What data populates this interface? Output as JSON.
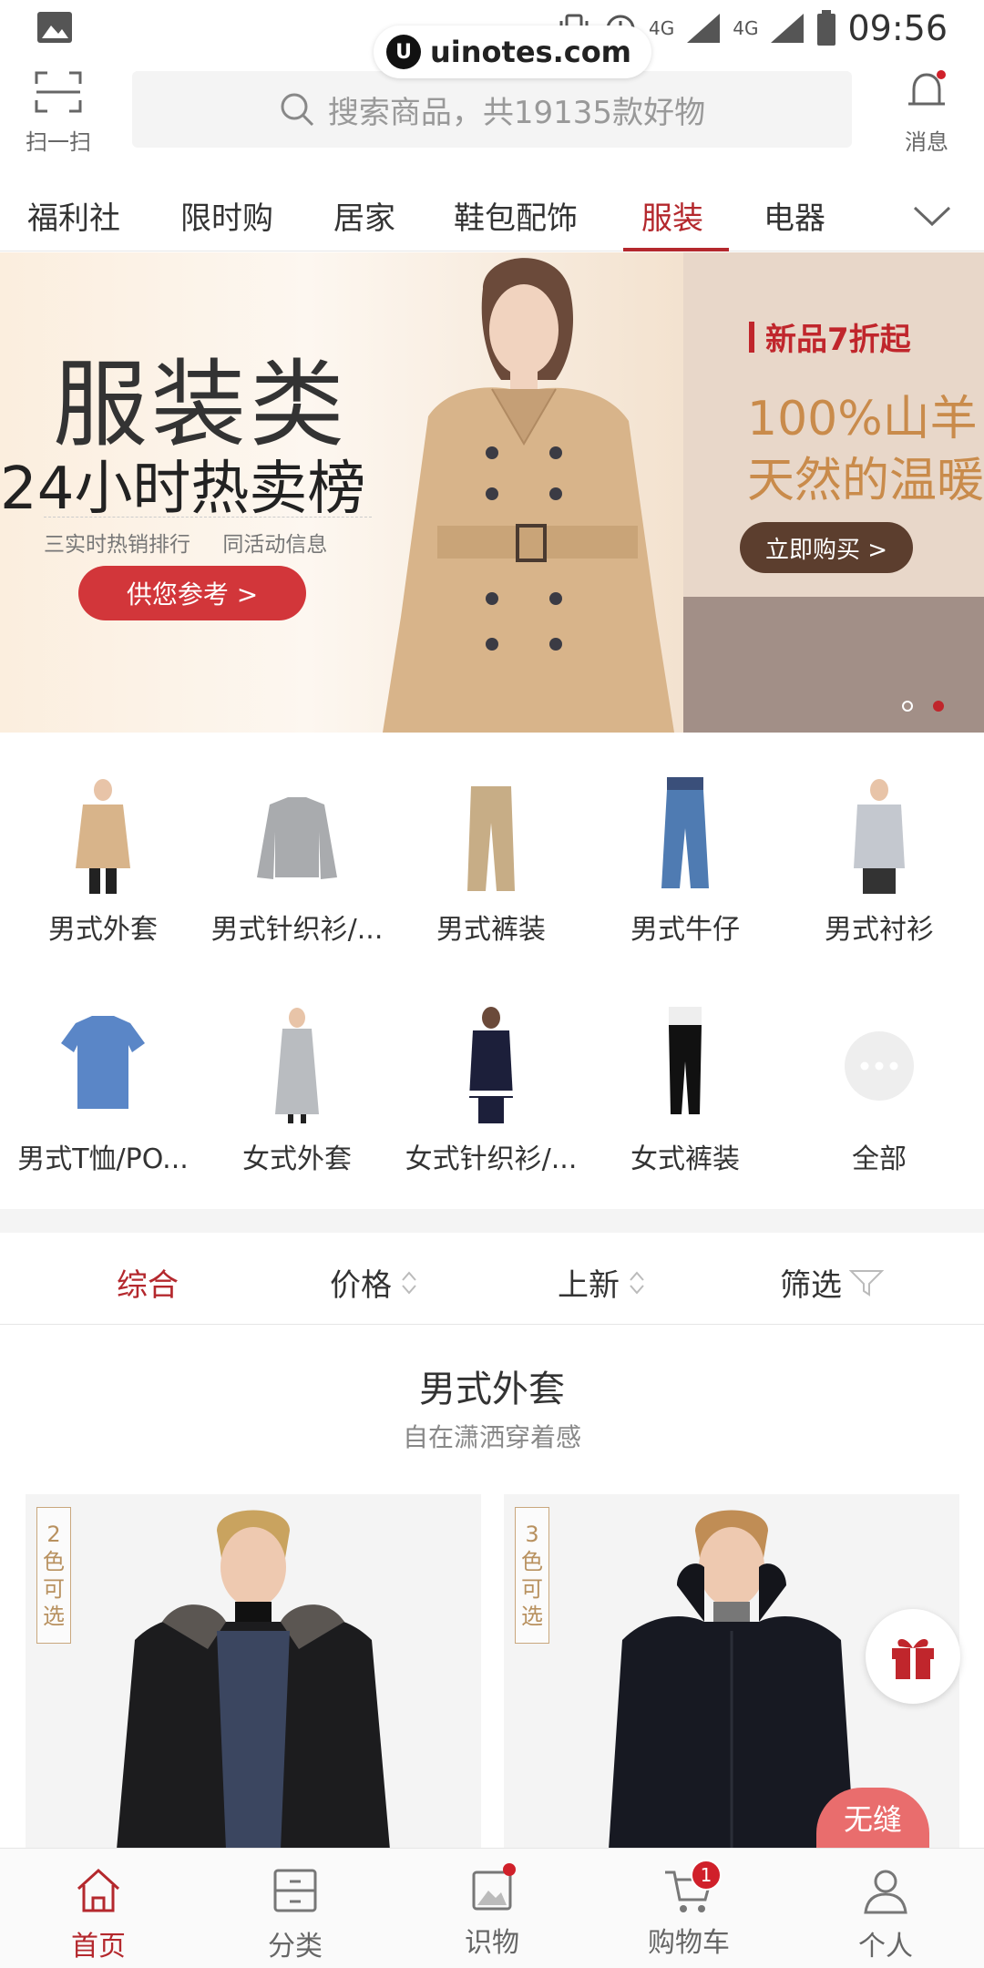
{
  "status_bar": {
    "time": "09:56",
    "network1": "4G",
    "network2": "4G"
  },
  "watermark": {
    "text": "uinotes.com"
  },
  "header": {
    "scan_label": "扫一扫",
    "search_placeholder": "搜索商品，共19135款好物",
    "message_label": "消息"
  },
  "tabs": [
    {
      "label": "福利社"
    },
    {
      "label": "限时购"
    },
    {
      "label": "居家"
    },
    {
      "label": "鞋包配饰"
    },
    {
      "label": "服装",
      "active": true
    },
    {
      "label": "电器"
    }
  ],
  "banner": {
    "title": "服装类",
    "subtitle": "24小时热卖榜",
    "tag1": "三实时热销排行",
    "tag2": "同活动信息",
    "button": "供您参考 >",
    "side_tag": "新品7折起",
    "side_line1": "100%山羊",
    "side_line2": "天然的温暖",
    "side_button": "立即购买 >"
  },
  "categories": [
    {
      "label": "男式外套"
    },
    {
      "label": "男式针织衫/..."
    },
    {
      "label": "男式裤装"
    },
    {
      "label": "男式牛仔"
    },
    {
      "label": "男式衬衫"
    },
    {
      "label": "男式T恤/PO..."
    },
    {
      "label": "女式外套"
    },
    {
      "label": "女式针织衫/..."
    },
    {
      "label": "女式裤装"
    },
    {
      "label": "全部"
    }
  ],
  "sort": {
    "comprehensive": "综合",
    "price": "价格",
    "new": "上新",
    "filter": "筛选"
  },
  "section": {
    "title": "男式外套",
    "subtitle": "自在潇洒穿着感"
  },
  "products": [
    {
      "color_tag": "2色可选"
    },
    {
      "color_tag": "3色可选"
    }
  ],
  "seamless_label": "无缝",
  "bottom_nav": [
    {
      "label": "首页",
      "active": true
    },
    {
      "label": "分类"
    },
    {
      "label": "识物"
    },
    {
      "label": "购物车",
      "badge": "1"
    },
    {
      "label": "个人"
    }
  ],
  "colors": {
    "accent": "#b4282d",
    "banner_button": "#d2363a"
  }
}
